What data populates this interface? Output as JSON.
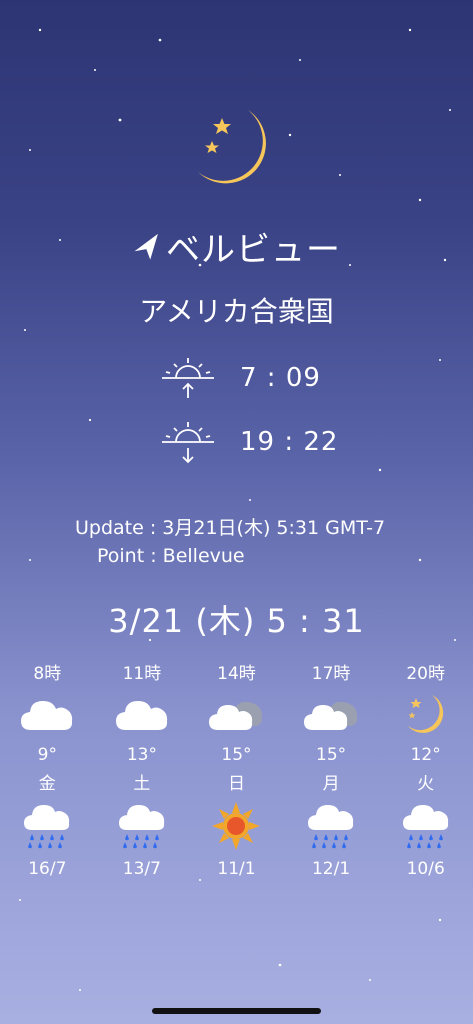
{
  "location": {
    "city": "ベルビュー",
    "country": "アメリカ合衆国"
  },
  "sun": {
    "sunrise": "7 : 09",
    "sunset": "19 : 22"
  },
  "update": {
    "line1": "Update : 3月21日(木) 5:31 GMT-7",
    "line2": "Point : Bellevue"
  },
  "current": {
    "datetime": "3/21 (木)  5 : 31"
  },
  "hourly": [
    {
      "time": "8時",
      "icon": "cloud-icon",
      "temp": "9°"
    },
    {
      "time": "11時",
      "icon": "cloud-icon",
      "temp": "13°"
    },
    {
      "time": "14時",
      "icon": "cloudy-icon",
      "temp": "15°"
    },
    {
      "time": "17時",
      "icon": "cloudy-icon",
      "temp": "15°"
    },
    {
      "time": "20時",
      "icon": "moon-stars-icon",
      "temp": "12°"
    }
  ],
  "daily": [
    {
      "day": "金",
      "icon": "rain-icon",
      "temps": "16/7"
    },
    {
      "day": "土",
      "icon": "rain-icon",
      "temps": "13/7"
    },
    {
      "day": "日",
      "icon": "sun-icon",
      "temps": "11/1"
    },
    {
      "day": "月",
      "icon": "rain-icon",
      "temps": "12/1"
    },
    {
      "day": "火",
      "icon": "rain-icon",
      "temps": "10/6"
    }
  ],
  "colors": {
    "moon": "#f6c65a",
    "rain": "#2f6cf0",
    "sun": "#f2a72a",
    "sun_core": "#e8562c"
  }
}
